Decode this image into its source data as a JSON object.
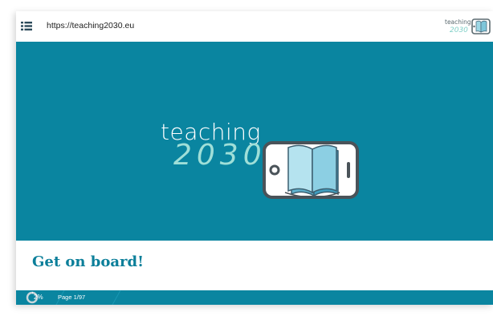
{
  "topbar": {
    "url": "https://teaching2030.eu",
    "brand_logo": {
      "word": "teaching",
      "year": "2030"
    }
  },
  "hero": {
    "logo": {
      "word": "teaching",
      "year": "2030"
    },
    "colors": {
      "background": "#0a85a0",
      "year": "#9fdfd8"
    }
  },
  "main": {
    "title": "Get on board!"
  },
  "footer": {
    "progress_percent_label": "2%",
    "progress_fraction": 0.02,
    "page_label": "Page 1/97"
  },
  "icons": {
    "menu": "list-menu-icon",
    "book": "tablet-book-icon",
    "progress": "progress-ring-icon"
  }
}
